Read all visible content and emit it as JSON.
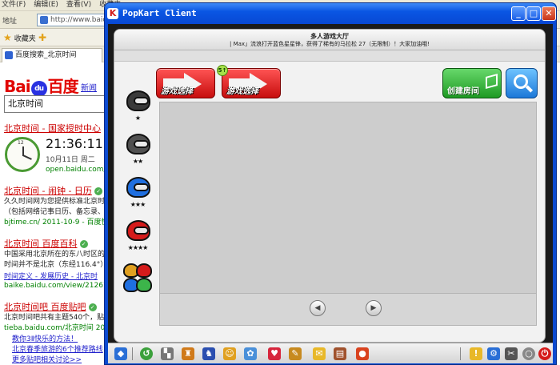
{
  "ie": {
    "menu": [
      "文件(F)",
      "编辑(E)",
      "查看(V)",
      "收藏夹"
    ],
    "address_prefix": "地址",
    "address": "http://www.baid",
    "favorites_label": "收藏夹",
    "tab_title": "百度搜索_北京时间",
    "baidu_logo_left": "Bai",
    "baidu_logo_paw": "du",
    "baidu_logo_right": "百度",
    "news_link": "新闻",
    "search_query": "北京时间",
    "results": [
      {
        "title": "北京时间 - 国家授时中心",
        "url": "open.baidu.com/"
      },
      {
        "title": "北京时间 - 闹钟 - 日历",
        "line1": "久久时间网为您提供标准北京时",
        "line2": "（包括网络记事日历、备忘录、",
        "url": "bjtime.cn/ 2011-10-9 - 百度快照"
      },
      {
        "title": "北京时间 百度百科",
        "line1": "中国采用北京所在的东八时区的",
        "line2": "时间并不是北京（东经116.4°）",
        "links": "时间定义 - 发展历史 - 北京时",
        "url": "baike.baidu.com/view/21267.ht"
      },
      {
        "title": "北京时间吧 百度贴吧",
        "line1": "北京时间吧共有主题540个，贴",
        "url": "tieba.baidu.com/北京时间 201",
        "sub1": "教你3Ⅱ快乐的方法！",
        "sub2": "北京春季旅游的6个推荐路线",
        "more": "更多贴吧相关讨论>>"
      }
    ],
    "clock_time": "21:36:11",
    "clock_date": "10月11日  周二",
    "clock_numeral": "12",
    "verified_mark": "✓",
    "right_strip": "N"
  },
  "popkart": {
    "window_title": "PopKart Client",
    "app_icon_glyph": "K",
    "buttons": {
      "minimize": "_",
      "maximize": "□",
      "close": "✕"
    },
    "lobby_title": "多人游戏大厅",
    "marquee": "| Max」流浪打开蓝色星星锋，获得了稀有的马拉松 27（无限制）！大家加油哦!",
    "mode_buttons": [
      {
        "label": "游戏选择"
      },
      {
        "label": "游戏选择"
      }
    ],
    "mode_badge": "5↑",
    "create_room_label": "创建房间",
    "helmet_ranks": [
      {
        "stars": "★",
        "color": "#3a3a3a"
      },
      {
        "stars": "★★",
        "color": "#505050"
      },
      {
        "stars": "★★★",
        "color": "#1f6fe0"
      },
      {
        "stars": "★★★★",
        "color": "#d51b1b"
      },
      {
        "stars": "",
        "color": "#e0a020"
      }
    ],
    "prev_page": "◀",
    "next_page": "▶",
    "taskbar_icons": [
      "start-icon",
      "back-icon",
      "kart-icon",
      "character-icon",
      "shop-icon",
      "pet-icon",
      "mail-icon",
      "heart-icon",
      "item-icon",
      "gift-icon",
      "book-icon",
      "garage-icon",
      "notice-icon",
      "settings-icon",
      "tools-icon",
      "zoom-icon",
      "exit-icon"
    ]
  },
  "colors": {
    "title_bar": "#0a56e3",
    "mode_red": "#c70e0e",
    "create_green": "#1e9a23",
    "search_blue": "#1c78d8"
  }
}
